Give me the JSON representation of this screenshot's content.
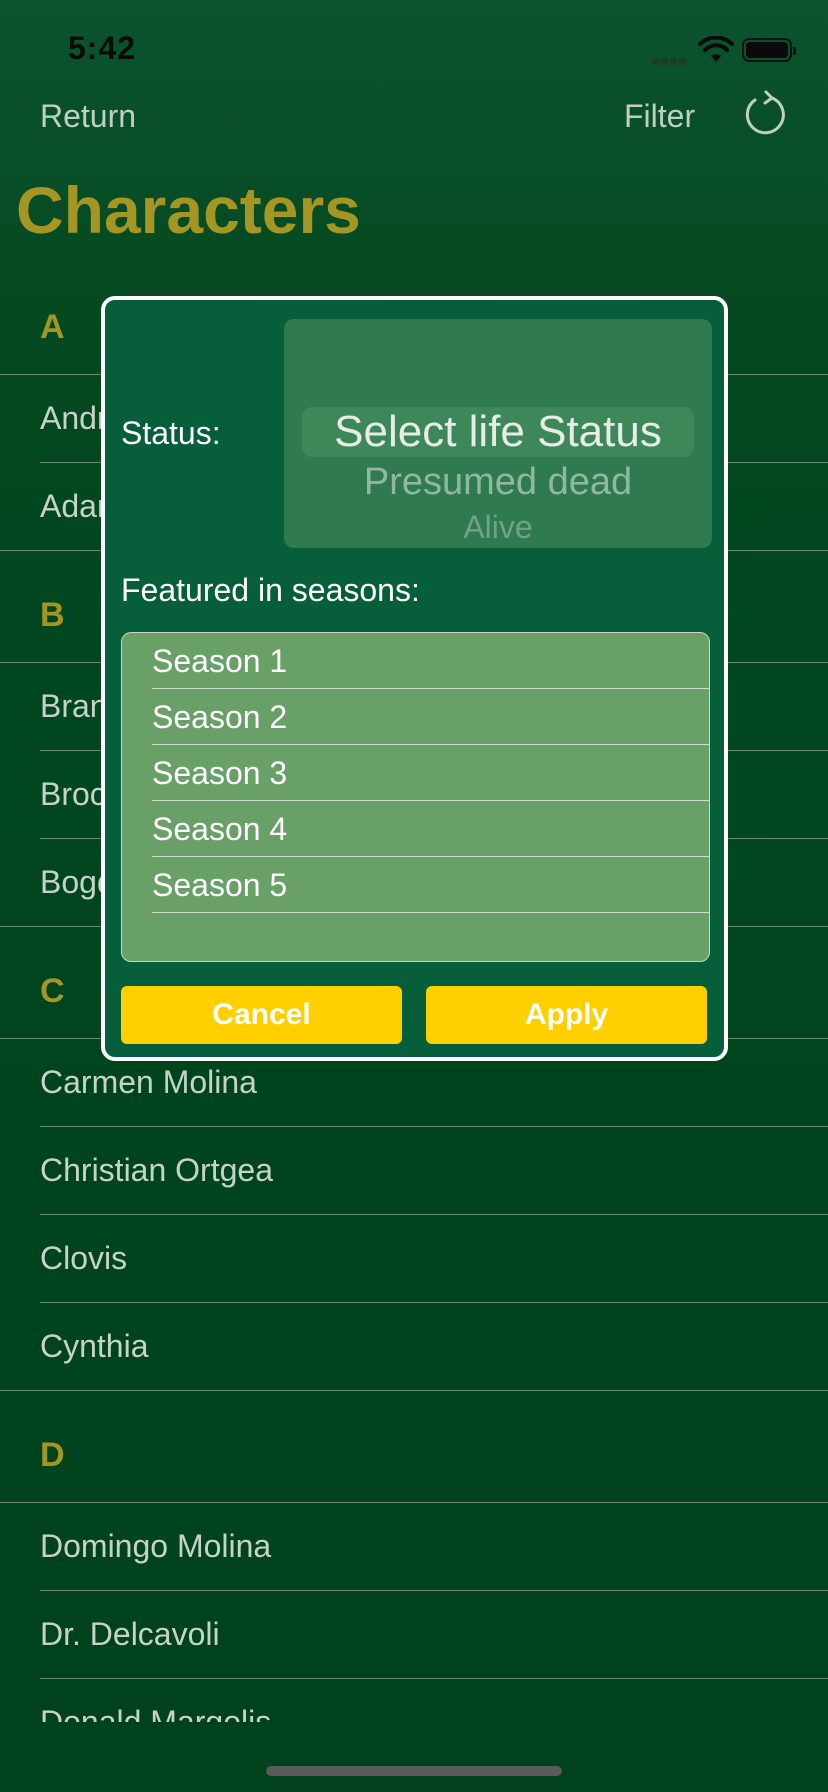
{
  "status_bar": {
    "time": "5:42"
  },
  "nav": {
    "return_label": "Return",
    "filter_label": "Filter",
    "refresh_icon": "refresh-icon"
  },
  "page_title": "Characters",
  "sections": [
    {
      "letter": "A",
      "items": [
        "Andrea",
        "Adam"
      ]
    },
    {
      "letter": "B",
      "items": [
        "Brandon",
        "Brock",
        "Bogdan"
      ]
    },
    {
      "letter": "C",
      "items": [
        "Carmen Molina",
        "Christian Ortgea",
        "Clovis",
        "Cynthia"
      ]
    },
    {
      "letter": "D",
      "items": [
        "Domingo Molina",
        "Dr. Delcavoli",
        "Donald Margolis"
      ]
    }
  ],
  "modal": {
    "status_label": "Status:",
    "picker": {
      "selected": "Select life Status",
      "next": "Presumed dead",
      "next2": "Alive"
    },
    "seasons_label": "Featured in seasons:",
    "seasons": [
      "Season 1",
      "Season 2",
      "Season 3",
      "Season 4",
      "Season 5"
    ],
    "cancel_label": "Cancel",
    "apply_label": "Apply"
  },
  "colors": {
    "background": "#00461f",
    "accent_gold": "#a59624",
    "button_yellow": "#ffcf00",
    "modal_bg": "#075e3a"
  }
}
